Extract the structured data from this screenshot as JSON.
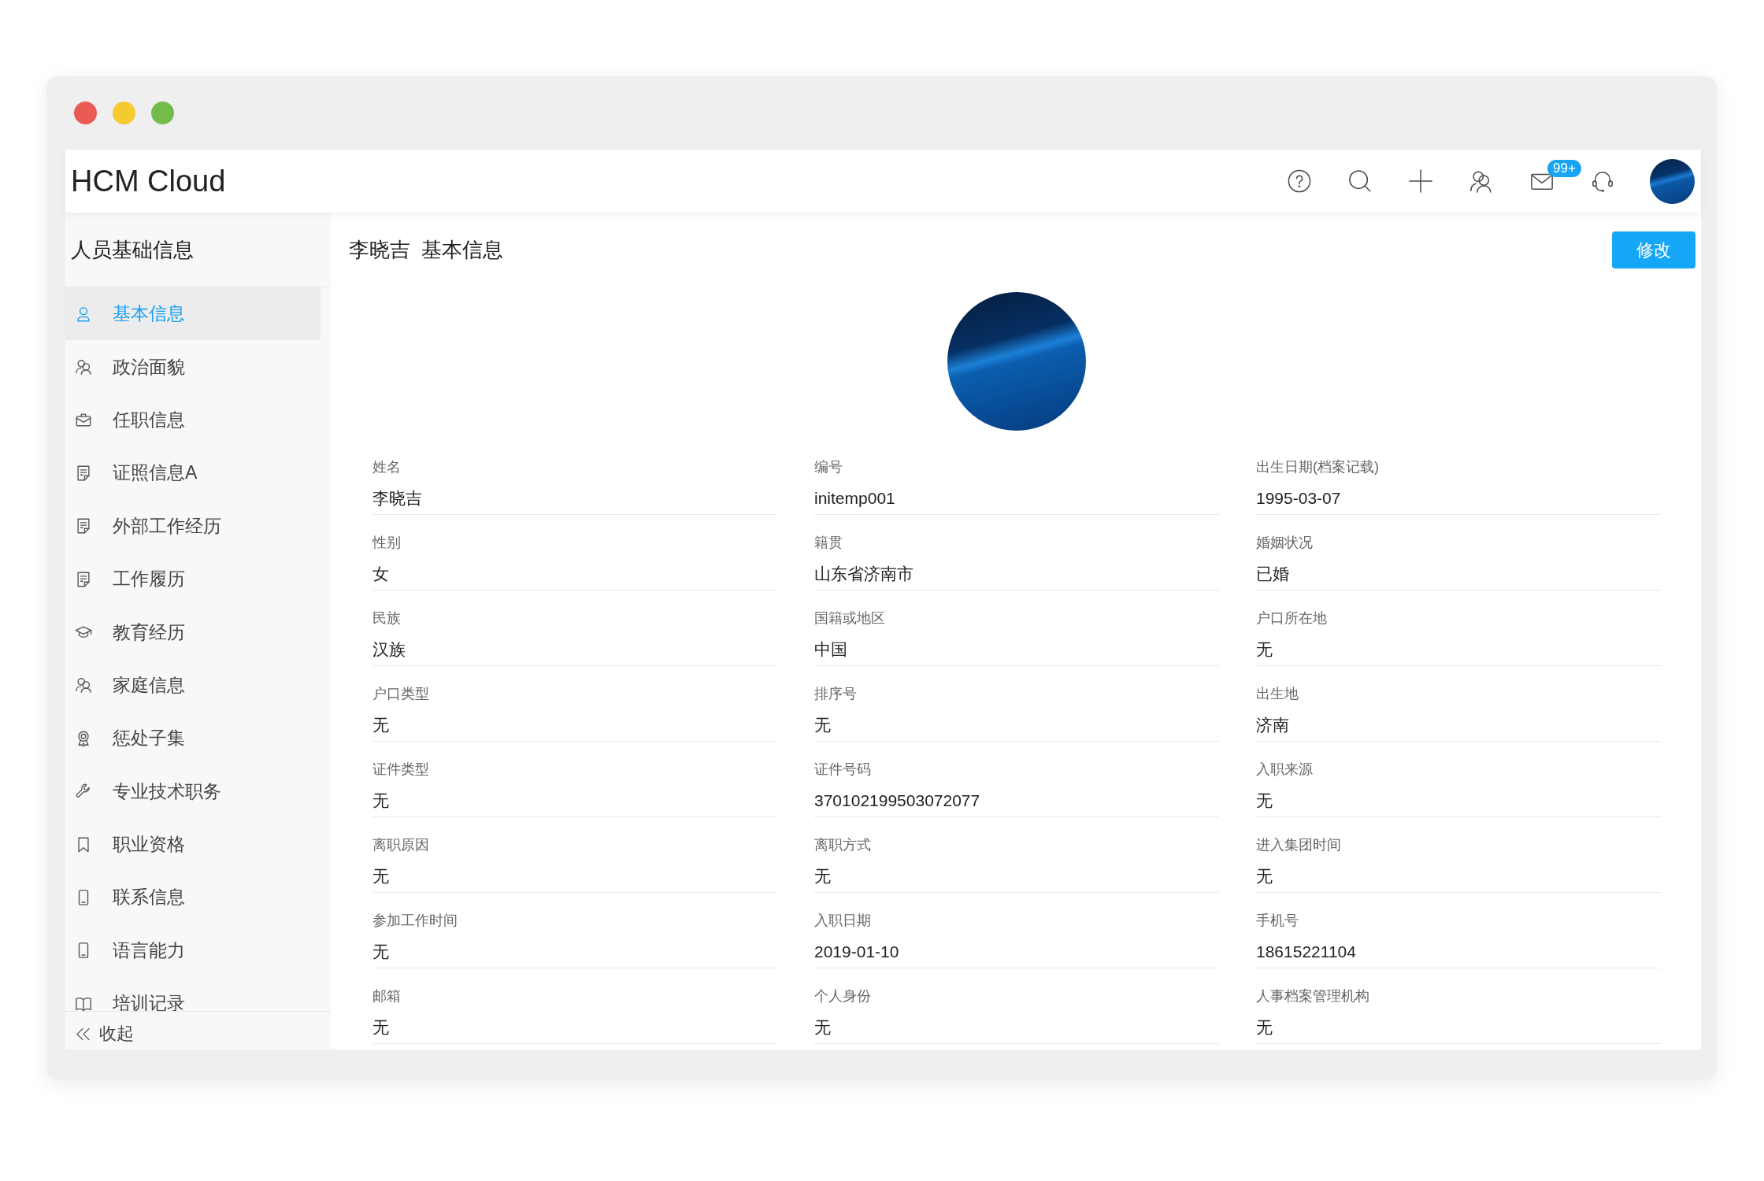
{
  "window_controls": [
    {
      "color": "#eb5b56"
    },
    {
      "color": "#f4ca30"
    },
    {
      "color": "#73bc4a"
    }
  ],
  "header": {
    "brand": "HCM Cloud",
    "actions": [
      {
        "kind": "help"
      },
      {
        "kind": "search"
      },
      {
        "kind": "add"
      },
      {
        "kind": "contacts"
      },
      {
        "kind": "mail",
        "badge": "99+"
      },
      {
        "kind": "support"
      }
    ]
  },
  "sidebar": {
    "title": "人员基础信息",
    "items": [
      {
        "kind": "person",
        "label": "基本信息",
        "selected": true
      },
      {
        "kind": "people",
        "label": "政治面貌",
        "selected": false
      },
      {
        "kind": "briefcase",
        "label": "任职信息",
        "selected": false
      },
      {
        "kind": "document",
        "label": "证照信息A",
        "selected": false
      },
      {
        "kind": "document",
        "label": "外部工作经历",
        "selected": false
      },
      {
        "kind": "document",
        "label": "工作履历",
        "selected": false
      },
      {
        "kind": "cap",
        "label": "教育经历",
        "selected": false
      },
      {
        "kind": "people",
        "label": "家庭信息",
        "selected": false
      },
      {
        "kind": "award",
        "label": "惩处子集",
        "selected": false
      },
      {
        "kind": "wrench",
        "label": "专业技术职务",
        "selected": false
      },
      {
        "kind": "bookmark",
        "label": "职业资格",
        "selected": false
      },
      {
        "kind": "phone",
        "label": "联系信息",
        "selected": false
      },
      {
        "kind": "phone",
        "label": "语言能力",
        "selected": false
      },
      {
        "kind": "book",
        "label": "培训记录",
        "selected": false
      }
    ],
    "collapse_label": "收起"
  },
  "profile": {
    "title": "李晓吉  基本信息",
    "edit_button": "修改",
    "fields": [
      {
        "label": "姓名",
        "value": "李晓吉"
      },
      {
        "label": "编号",
        "value": "initemp001"
      },
      {
        "label": "出生日期(档案记载)",
        "value": "1995-03-07"
      },
      {
        "label": "性别",
        "value": "女"
      },
      {
        "label": "籍贯",
        "value": "山东省济南市"
      },
      {
        "label": "婚姻状况",
        "value": "已婚"
      },
      {
        "label": "民族",
        "value": "汉族"
      },
      {
        "label": "国籍或地区",
        "value": "中国"
      },
      {
        "label": "户口所在地",
        "value": "无"
      },
      {
        "label": "户口类型",
        "value": "无"
      },
      {
        "label": "排序号",
        "value": "无"
      },
      {
        "label": "出生地",
        "value": "济南"
      },
      {
        "label": "证件类型",
        "value": "无"
      },
      {
        "label": "证件号码",
        "value": "370102199503072077"
      },
      {
        "label": "入职来源",
        "value": "无"
      },
      {
        "label": "离职原因",
        "value": "无"
      },
      {
        "label": "离职方式",
        "value": "无"
      },
      {
        "label": "进入集团时间",
        "value": "无"
      },
      {
        "label": "参加工作时间",
        "value": "无"
      },
      {
        "label": "入职日期",
        "value": "2019-01-10"
      },
      {
        "label": "手机号",
        "value": "18615221104"
      },
      {
        "label": "邮箱",
        "value": "无"
      },
      {
        "label": "个人身份",
        "value": "无"
      },
      {
        "label": "人事档案管理机构",
        "value": "无"
      }
    ]
  }
}
